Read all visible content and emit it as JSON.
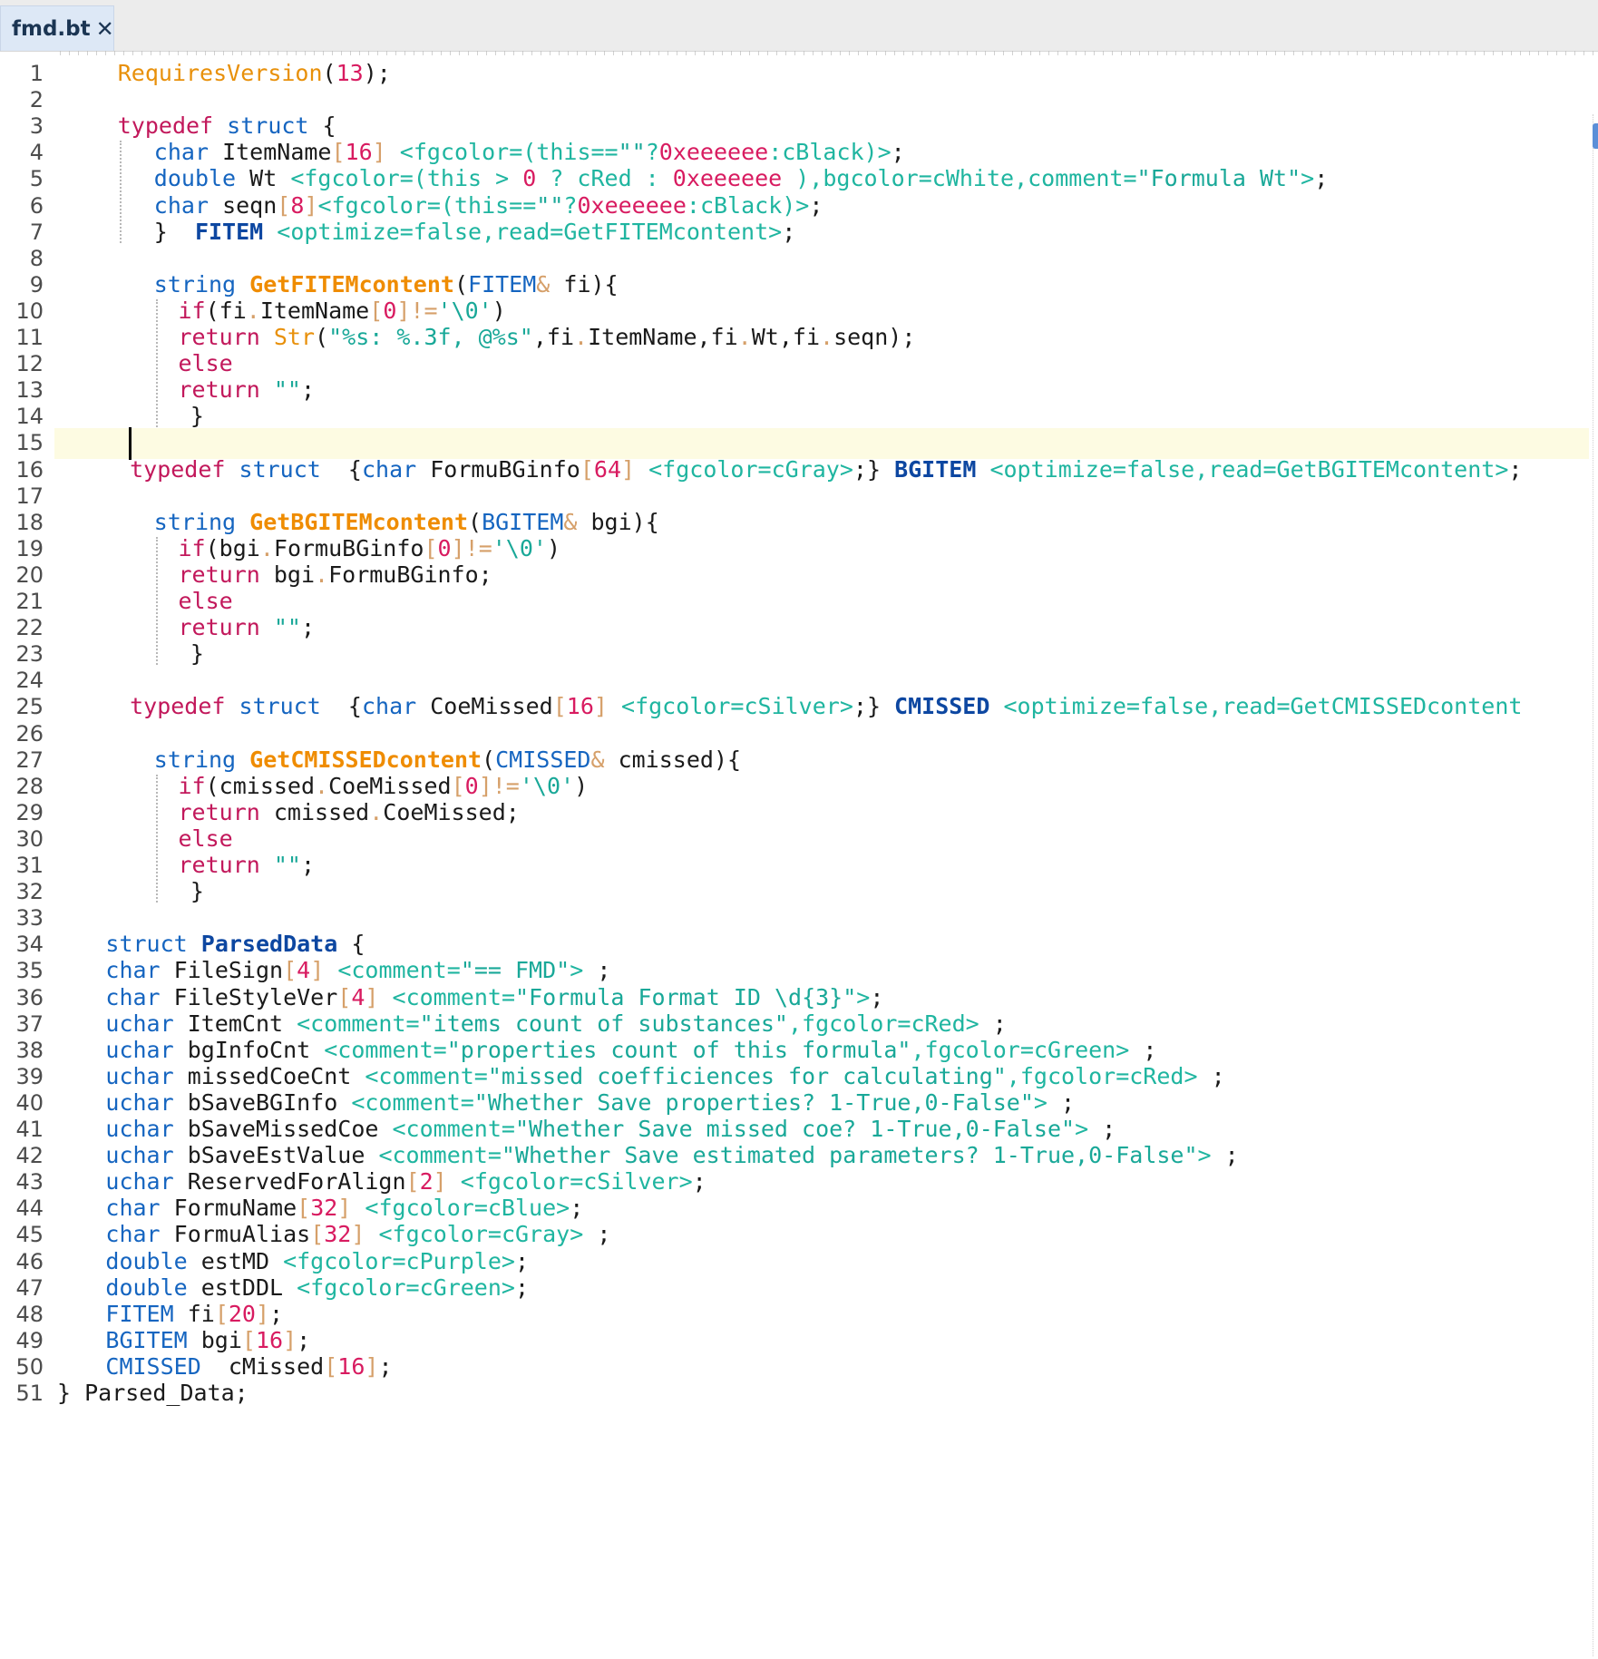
{
  "tab": {
    "label": "fmd.bt",
    "close_glyph": "✕"
  },
  "colors": {
    "keyword": "#c2185b",
    "type": "#1565c0",
    "function": "#ef8c00",
    "attribute": "#1fb5a0",
    "string": "#19a898",
    "number": "#d81b60",
    "operator": "#d6a06a",
    "struct_name": "#0d47a1",
    "text": "#1a1a1a",
    "current_line": "#fdfbe2"
  },
  "editor": {
    "current_line": 15
  },
  "lines": [
    {
      "n": "1",
      "indent": 5,
      "t": [
        [
          "fo",
          "RequiresVersion"
        ],
        [
          "tx",
          "("
        ],
        [
          "nu",
          "13"
        ],
        [
          "tx",
          ");"
        ]
      ]
    },
    {
      "n": "2",
      "indent": 0,
      "t": []
    },
    {
      "n": "3",
      "indent": 5,
      "t": [
        [
          "kw",
          "typedef"
        ],
        [
          "tx",
          " "
        ],
        [
          "ty",
          "struct"
        ],
        [
          "tx",
          " {"
        ]
      ]
    },
    {
      "n": "4",
      "indent": 8,
      "t": [
        [
          "ty",
          "char"
        ],
        [
          "tx",
          " ItemName"
        ],
        [
          "op",
          "["
        ],
        [
          "nu",
          "16"
        ],
        [
          "op",
          "]"
        ],
        [
          "tx",
          " "
        ],
        [
          "at",
          "<fgcolor=(this=="
        ],
        [
          "st",
          "\"\""
        ],
        [
          "at",
          "?"
        ],
        [
          "nu",
          "0xeeeeee"
        ],
        [
          "at",
          ":cBlack)>"
        ],
        [
          "tx",
          ";"
        ]
      ]
    },
    {
      "n": "5",
      "indent": 8,
      "t": [
        [
          "ty",
          "double"
        ],
        [
          "tx",
          " Wt "
        ],
        [
          "at",
          "<fgcolor=(this > "
        ],
        [
          "nu",
          "0"
        ],
        [
          "at",
          " ? cRed : "
        ],
        [
          "nu",
          "0xeeeeee"
        ],
        [
          "at",
          " ),bgcolor=cWhite,comment="
        ],
        [
          "st",
          "\"Formula Wt\""
        ],
        [
          "at",
          ">"
        ],
        [
          "tx",
          ";"
        ]
      ]
    },
    {
      "n": "6",
      "indent": 8,
      "t": [
        [
          "ty",
          "char"
        ],
        [
          "tx",
          " seqn"
        ],
        [
          "op",
          "["
        ],
        [
          "nu",
          "8"
        ],
        [
          "op",
          "]"
        ],
        [
          "at",
          "<fgcolor=(this=="
        ],
        [
          "st",
          "\"\""
        ],
        [
          "at",
          "?"
        ],
        [
          "nu",
          "0xeeeeee"
        ],
        [
          "at",
          ":cBlack)>"
        ],
        [
          "tx",
          ";"
        ]
      ]
    },
    {
      "n": "7",
      "indent": 8,
      "t": [
        [
          "tx",
          "}  "
        ],
        [
          "sd",
          "FITEM"
        ],
        [
          "tx",
          " "
        ],
        [
          "at",
          "<optimize=false,read=GetFITEMcontent>"
        ],
        [
          "tx",
          ";"
        ]
      ]
    },
    {
      "n": "8",
      "indent": 0,
      "t": []
    },
    {
      "n": "9",
      "indent": 8,
      "t": [
        [
          "ty",
          "string"
        ],
        [
          "tx",
          " "
        ],
        [
          "fn",
          "GetFITEMcontent"
        ],
        [
          "tx",
          "("
        ],
        [
          "ty",
          "FITEM"
        ],
        [
          "op",
          "&"
        ],
        [
          "tx",
          " fi){"
        ]
      ]
    },
    {
      "n": "10",
      "indent": 10,
      "t": [
        [
          "kw",
          "if"
        ],
        [
          "tx",
          "(fi"
        ],
        [
          "op",
          "."
        ],
        [
          "tx",
          "ItemName"
        ],
        [
          "op",
          "["
        ],
        [
          "nu",
          "0"
        ],
        [
          "op",
          "]!="
        ],
        [
          "st",
          "'\\0'"
        ],
        [
          "tx",
          ")"
        ]
      ]
    },
    {
      "n": "11",
      "indent": 10,
      "t": [
        [
          "kw",
          "return"
        ],
        [
          "tx",
          " "
        ],
        [
          "fo",
          "Str"
        ],
        [
          "tx",
          "("
        ],
        [
          "st",
          "\"%s: %.3f, @%s\""
        ],
        [
          "tx",
          ",fi"
        ],
        [
          "op",
          "."
        ],
        [
          "tx",
          "ItemName,fi"
        ],
        [
          "op",
          "."
        ],
        [
          "tx",
          "Wt,fi"
        ],
        [
          "op",
          "."
        ],
        [
          "tx",
          "seqn);"
        ]
      ]
    },
    {
      "n": "12",
      "indent": 10,
      "t": [
        [
          "kw",
          "else"
        ]
      ]
    },
    {
      "n": "13",
      "indent": 10,
      "t": [
        [
          "kw",
          "return"
        ],
        [
          "tx",
          " "
        ],
        [
          "st",
          "\"\""
        ],
        [
          "tx",
          ";"
        ]
      ]
    },
    {
      "n": "14",
      "indent": 11,
      "t": [
        [
          "tx",
          "}"
        ]
      ]
    },
    {
      "n": "15",
      "indent": 0,
      "t": []
    },
    {
      "n": "16",
      "indent": 6,
      "t": [
        [
          "kw",
          "typedef"
        ],
        [
          "tx",
          " "
        ],
        [
          "ty",
          "struct"
        ],
        [
          "tx",
          "  {"
        ],
        [
          "ty",
          "char"
        ],
        [
          "tx",
          " FormuBGinfo"
        ],
        [
          "op",
          "["
        ],
        [
          "nu",
          "64"
        ],
        [
          "op",
          "]"
        ],
        [
          "tx",
          " "
        ],
        [
          "at",
          "<fgcolor=cGray>"
        ],
        [
          "tx",
          ";} "
        ],
        [
          "sd",
          "BGITEM"
        ],
        [
          "tx",
          " "
        ],
        [
          "at",
          "<optimize=false,read=GetBGITEMcontent>"
        ],
        [
          "tx",
          ";"
        ]
      ]
    },
    {
      "n": "17",
      "indent": 0,
      "t": []
    },
    {
      "n": "18",
      "indent": 8,
      "t": [
        [
          "ty",
          "string"
        ],
        [
          "tx",
          " "
        ],
        [
          "fn",
          "GetBGITEMcontent"
        ],
        [
          "tx",
          "("
        ],
        [
          "ty",
          "BGITEM"
        ],
        [
          "op",
          "&"
        ],
        [
          "tx",
          " bgi){"
        ]
      ]
    },
    {
      "n": "19",
      "indent": 10,
      "t": [
        [
          "kw",
          "if"
        ],
        [
          "tx",
          "(bgi"
        ],
        [
          "op",
          "."
        ],
        [
          "tx",
          "FormuBGinfo"
        ],
        [
          "op",
          "["
        ],
        [
          "nu",
          "0"
        ],
        [
          "op",
          "]!="
        ],
        [
          "st",
          "'\\0'"
        ],
        [
          "tx",
          ")"
        ]
      ]
    },
    {
      "n": "20",
      "indent": 10,
      "t": [
        [
          "kw",
          "return"
        ],
        [
          "tx",
          " bgi"
        ],
        [
          "op",
          "."
        ],
        [
          "tx",
          "FormuBGinfo;"
        ]
      ]
    },
    {
      "n": "21",
      "indent": 10,
      "t": [
        [
          "kw",
          "else"
        ]
      ]
    },
    {
      "n": "22",
      "indent": 10,
      "t": [
        [
          "kw",
          "return"
        ],
        [
          "tx",
          " "
        ],
        [
          "st",
          "\"\""
        ],
        [
          "tx",
          ";"
        ]
      ]
    },
    {
      "n": "23",
      "indent": 11,
      "t": [
        [
          "tx",
          "}"
        ]
      ]
    },
    {
      "n": "24",
      "indent": 0,
      "t": []
    },
    {
      "n": "25",
      "indent": 6,
      "t": [
        [
          "kw",
          "typedef"
        ],
        [
          "tx",
          " "
        ],
        [
          "ty",
          "struct"
        ],
        [
          "tx",
          "  {"
        ],
        [
          "ty",
          "char"
        ],
        [
          "tx",
          " CoeMissed"
        ],
        [
          "op",
          "["
        ],
        [
          "nu",
          "16"
        ],
        [
          "op",
          "]"
        ],
        [
          "tx",
          " "
        ],
        [
          "at",
          "<fgcolor=cSilver>"
        ],
        [
          "tx",
          ";} "
        ],
        [
          "sd",
          "CMISSED"
        ],
        [
          "tx",
          " "
        ],
        [
          "at",
          "<optimize=false,read=GetCMISSEDcontent"
        ]
      ]
    },
    {
      "n": "26",
      "indent": 0,
      "t": []
    },
    {
      "n": "27",
      "indent": 8,
      "t": [
        [
          "ty",
          "string"
        ],
        [
          "tx",
          " "
        ],
        [
          "fn",
          "GetCMISSEDcontent"
        ],
        [
          "tx",
          "("
        ],
        [
          "ty",
          "CMISSED"
        ],
        [
          "op",
          "&"
        ],
        [
          "tx",
          " cmissed){"
        ]
      ]
    },
    {
      "n": "28",
      "indent": 10,
      "t": [
        [
          "kw",
          "if"
        ],
        [
          "tx",
          "(cmissed"
        ],
        [
          "op",
          "."
        ],
        [
          "tx",
          "CoeMissed"
        ],
        [
          "op",
          "["
        ],
        [
          "nu",
          "0"
        ],
        [
          "op",
          "]!="
        ],
        [
          "st",
          "'\\0'"
        ],
        [
          "tx",
          ")"
        ]
      ]
    },
    {
      "n": "29",
      "indent": 10,
      "t": [
        [
          "kw",
          "return"
        ],
        [
          "tx",
          " cmissed"
        ],
        [
          "op",
          "."
        ],
        [
          "tx",
          "CoeMissed;"
        ]
      ]
    },
    {
      "n": "30",
      "indent": 10,
      "t": [
        [
          "kw",
          "else"
        ]
      ]
    },
    {
      "n": "31",
      "indent": 10,
      "t": [
        [
          "kw",
          "return"
        ],
        [
          "tx",
          " "
        ],
        [
          "st",
          "\"\""
        ],
        [
          "tx",
          ";"
        ]
      ]
    },
    {
      "n": "32",
      "indent": 11,
      "t": [
        [
          "tx",
          "}"
        ]
      ]
    },
    {
      "n": "33",
      "indent": 0,
      "t": []
    },
    {
      "n": "34",
      "indent": 4,
      "t": [
        [
          "ty",
          "struct"
        ],
        [
          "tx",
          " "
        ],
        [
          "sd",
          "ParsedData"
        ],
        [
          "tx",
          " {"
        ]
      ]
    },
    {
      "n": "35",
      "indent": 4,
      "t": [
        [
          "ty",
          "char"
        ],
        [
          "tx",
          " FileSign"
        ],
        [
          "op",
          "["
        ],
        [
          "nu",
          "4"
        ],
        [
          "op",
          "]"
        ],
        [
          "tx",
          " "
        ],
        [
          "at",
          "<comment="
        ],
        [
          "st",
          "\"== FMD\""
        ],
        [
          "at",
          ">"
        ],
        [
          "tx",
          " ;"
        ]
      ]
    },
    {
      "n": "36",
      "indent": 4,
      "t": [
        [
          "ty",
          "char"
        ],
        [
          "tx",
          " FileStyleVer"
        ],
        [
          "op",
          "["
        ],
        [
          "nu",
          "4"
        ],
        [
          "op",
          "]"
        ],
        [
          "tx",
          " "
        ],
        [
          "at",
          "<comment="
        ],
        [
          "st",
          "\"Formula Format ID \\d{3}\""
        ],
        [
          "at",
          ">"
        ],
        [
          "tx",
          ";"
        ]
      ]
    },
    {
      "n": "37",
      "indent": 4,
      "t": [
        [
          "ty",
          "uchar"
        ],
        [
          "tx",
          " ItemCnt "
        ],
        [
          "at",
          "<comment="
        ],
        [
          "st",
          "\"items count of substances\""
        ],
        [
          "at",
          ",fgcolor=cRed>"
        ],
        [
          "tx",
          " ;"
        ]
      ]
    },
    {
      "n": "38",
      "indent": 4,
      "t": [
        [
          "ty",
          "uchar"
        ],
        [
          "tx",
          " bgInfoCnt "
        ],
        [
          "at",
          "<comment="
        ],
        [
          "st",
          "\"properties count of this formula\""
        ],
        [
          "at",
          ",fgcolor=cGreen>"
        ],
        [
          "tx",
          " ;"
        ]
      ]
    },
    {
      "n": "39",
      "indent": 4,
      "t": [
        [
          "ty",
          "uchar"
        ],
        [
          "tx",
          " missedCoeCnt "
        ],
        [
          "at",
          "<comment="
        ],
        [
          "st",
          "\"missed coefficiences for calculating\""
        ],
        [
          "at",
          ",fgcolor=cRed>"
        ],
        [
          "tx",
          " ;"
        ]
      ]
    },
    {
      "n": "40",
      "indent": 4,
      "t": [
        [
          "ty",
          "uchar"
        ],
        [
          "tx",
          " bSaveBGInfo "
        ],
        [
          "at",
          "<comment="
        ],
        [
          "st",
          "\"Whether Save properties? 1-True,0-False\""
        ],
        [
          "at",
          ">"
        ],
        [
          "tx",
          " ;"
        ]
      ]
    },
    {
      "n": "41",
      "indent": 4,
      "t": [
        [
          "ty",
          "uchar"
        ],
        [
          "tx",
          " bSaveMissedCoe "
        ],
        [
          "at",
          "<comment="
        ],
        [
          "st",
          "\"Whether Save missed coe? 1-True,0-False\""
        ],
        [
          "at",
          ">"
        ],
        [
          "tx",
          " ;"
        ]
      ]
    },
    {
      "n": "42",
      "indent": 4,
      "t": [
        [
          "ty",
          "uchar"
        ],
        [
          "tx",
          " bSaveEstValue "
        ],
        [
          "at",
          "<comment="
        ],
        [
          "st",
          "\"Whether Save estimated parameters? 1-True,0-False\""
        ],
        [
          "at",
          ">"
        ],
        [
          "tx",
          " ;"
        ]
      ]
    },
    {
      "n": "43",
      "indent": 4,
      "t": [
        [
          "ty",
          "uchar"
        ],
        [
          "tx",
          " ReservedForAlign"
        ],
        [
          "op",
          "["
        ],
        [
          "nu",
          "2"
        ],
        [
          "op",
          "]"
        ],
        [
          "tx",
          " "
        ],
        [
          "at",
          "<fgcolor=cSilver>"
        ],
        [
          "tx",
          ";"
        ]
      ]
    },
    {
      "n": "44",
      "indent": 4,
      "t": [
        [
          "ty",
          "char"
        ],
        [
          "tx",
          " FormuName"
        ],
        [
          "op",
          "["
        ],
        [
          "nu",
          "32"
        ],
        [
          "op",
          "]"
        ],
        [
          "tx",
          " "
        ],
        [
          "at",
          "<fgcolor=cBlue>"
        ],
        [
          "tx",
          ";"
        ]
      ]
    },
    {
      "n": "45",
      "indent": 4,
      "t": [
        [
          "ty",
          "char"
        ],
        [
          "tx",
          " FormuAlias"
        ],
        [
          "op",
          "["
        ],
        [
          "nu",
          "32"
        ],
        [
          "op",
          "]"
        ],
        [
          "tx",
          " "
        ],
        [
          "at",
          "<fgcolor=cGray>"
        ],
        [
          "tx",
          " ;"
        ]
      ]
    },
    {
      "n": "46",
      "indent": 4,
      "t": [
        [
          "ty",
          "double"
        ],
        [
          "tx",
          " estMD "
        ],
        [
          "at",
          "<fgcolor=cPurple>"
        ],
        [
          "tx",
          ";"
        ]
      ]
    },
    {
      "n": "47",
      "indent": 4,
      "t": [
        [
          "ty",
          "double"
        ],
        [
          "tx",
          " estDDL "
        ],
        [
          "at",
          "<fgcolor=cGreen>"
        ],
        [
          "tx",
          ";"
        ]
      ]
    },
    {
      "n": "48",
      "indent": 4,
      "t": [
        [
          "ty",
          "FITEM"
        ],
        [
          "tx",
          " fi"
        ],
        [
          "op",
          "["
        ],
        [
          "nu",
          "20"
        ],
        [
          "op",
          "]"
        ],
        [
          "tx",
          ";"
        ]
      ]
    },
    {
      "n": "49",
      "indent": 4,
      "t": [
        [
          "ty",
          "BGITEM"
        ],
        [
          "tx",
          " bgi"
        ],
        [
          "op",
          "["
        ],
        [
          "nu",
          "16"
        ],
        [
          "op",
          "]"
        ],
        [
          "tx",
          ";"
        ]
      ]
    },
    {
      "n": "50",
      "indent": 4,
      "t": [
        [
          "ty",
          "CMISSED"
        ],
        [
          "tx",
          "  cMissed"
        ],
        [
          "op",
          "["
        ],
        [
          "nu",
          "16"
        ],
        [
          "op",
          "]"
        ],
        [
          "tx",
          ";"
        ]
      ]
    },
    {
      "n": "51",
      "indent": 0,
      "t": [
        [
          "tx",
          "} Parsed_Data;"
        ]
      ]
    }
  ]
}
